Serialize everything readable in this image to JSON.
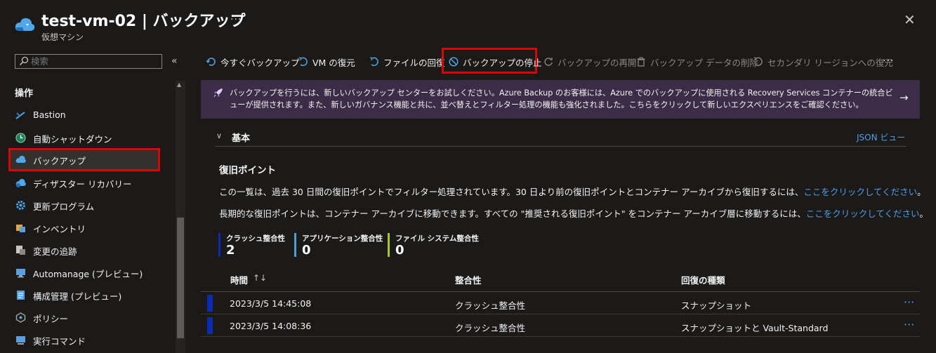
{
  "header": {
    "title": "test-vm-02 | バックアップ",
    "subtitle": "仮想マシン",
    "more": "···",
    "close": "✕"
  },
  "sidebar": {
    "search_placeholder": "検索",
    "collapse": "«",
    "section": "操作",
    "items": [
      {
        "label": "Bastion",
        "icon": "bastion-icon"
      },
      {
        "label": "自動シャットダウン",
        "icon": "clock-icon"
      },
      {
        "label": "バックアップ",
        "icon": "backup-cloud-icon",
        "selected": true
      },
      {
        "label": "ディザスター リカバリー",
        "icon": "cloud-recovery-icon"
      },
      {
        "label": "更新プログラム",
        "icon": "gear-icon"
      },
      {
        "label": "インベントリ",
        "icon": "inventory-icon"
      },
      {
        "label": "変更の追跡",
        "icon": "change-tracking-icon"
      },
      {
        "label": "Automanage (プレビュー)",
        "icon": "automanage-icon"
      },
      {
        "label": "構成管理 (プレビュー)",
        "icon": "config-icon"
      },
      {
        "label": "ポリシー",
        "icon": "policy-icon"
      },
      {
        "label": "実行コマンド",
        "icon": "run-command-icon"
      }
    ]
  },
  "toolbar": {
    "backup_now": "今すぐバックアップ",
    "restore_vm": "VM の復元",
    "file_recovery": "ファイルの回復",
    "stop_backup": "バックアップの停止",
    "resume_backup": "バックアップの再開",
    "delete_backup_data": "バックアップ データの削除",
    "secondary_region_restore": "セカンダリ リージョンへの復元",
    "more": "···"
  },
  "banner": {
    "text": "バックアップを行うには、新しいバックアップ センターをお試しください。Azure Backup のお客様には、Azure でのバックアップに使用される Recovery Services コンテナーの統合ビューが提供されます。また、新しいガバナンス機能と共に、並べ替えとフィルター処理の機能も強化されました。こちらをクリックして新しいエクスペリエンスをご確認ください。",
    "arrow": "→"
  },
  "essentials": {
    "chevron": "∨",
    "label": "基本",
    "json_view": "JSON ビュー"
  },
  "recovery": {
    "title": "復旧ポイント",
    "para1": "この一覧は、過去 30 日間の復旧ポイントでフィルター処理されています。30 日より前の復旧ポイントとコンテナー アーカイブから復旧するには、",
    "para1_link": "ここをクリックしてください",
    "para1_end": "。",
    "para2": "長期的な復旧ポイントは、コンテナー アーカイブに移動できます。すべての \"推奨される復旧ポイント\" をコンテナー アーカイブ層に移動するには、",
    "para2_link": "ここをクリックしてください",
    "para2_end": "。"
  },
  "stats": [
    {
      "label": "クラッシュ整合性",
      "value": "2",
      "color": "#0a2bb8"
    },
    {
      "label": "アプリケーション整合性",
      "value": "0",
      "color": "#4a9fd8"
    },
    {
      "label": "ファイル システム整合性",
      "value": "0",
      "color": "#a4c62e"
    }
  ],
  "table": {
    "headers": {
      "time": "時間",
      "sort": "↑↓",
      "consistency": "整合性",
      "type": "回復の種類"
    },
    "rows": [
      {
        "time": "2023/3/5 14:45:08",
        "consistency": "クラッシュ整合性",
        "type": "スナップショット",
        "more": "···"
      },
      {
        "time": "2023/3/5 14:08:36",
        "consistency": "クラッシュ整合性",
        "type": "スナップショットと Vault-Standard",
        "more": "···"
      }
    ]
  },
  "colors": {
    "accent_link": "#4f9fe8",
    "highlight_red": "#e00000",
    "banner_bg": "#3b2d48",
    "background": "#1b1a19"
  }
}
